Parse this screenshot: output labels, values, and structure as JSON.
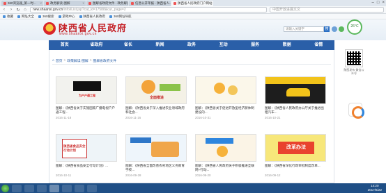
{
  "browser": {
    "tabs": [
      {
        "label": "360浏览器_第一时...",
        "active": false
      },
      {
        "label": "政务解读-图解",
        "active": false
      },
      {
        "label": "图解省政府文件 - 政务解读",
        "active": false
      },
      {
        "label": "信息公开年报 - 陕西省人...",
        "active": false
      },
      {
        "label": "陕西省人民政府门户网站",
        "active": true
      }
    ],
    "url_domain": "new.shaanxi.gov.cn",
    "url_path": "/info/iList.jsp?cat_id=17588&cur_page=2",
    "search_placeholder": "中国开放进展文文",
    "bookmarks": [
      "收藏",
      "网址大全",
      "360搜索",
      "游戏中心",
      "陕西省人民政府",
      "360网址导航"
    ]
  },
  "site": {
    "title": "陕西省人民政府",
    "url": "www.shaanxi.gov.cn",
    "search_placeholder": "请输入关键字",
    "search_button": "搜",
    "weather": "26°C",
    "nav": [
      "首页",
      "省政府",
      "省长",
      "新闻",
      "政务",
      "互动",
      "服务",
      "数据",
      "省情"
    ],
    "breadcrumb": [
      "首页",
      "政策解读·图解",
      "图解省政府文件"
    ],
    "qr_label": "陕西发布 微信公众号",
    "cards": [
      {
        "caption": "图解：《陕西省关于实施国家广播电视户户通工程...",
        "date": "2016-11-18"
      },
      {
        "caption": "图解：《陕西省关于深入推进农业领域政府和社会...",
        "date": "2016-11-16"
      },
      {
        "caption": "图解：《陕西省关于促进开放型经济新体制建设的...",
        "date": "2016-10-31"
      },
      {
        "caption": "图解：《陕西省人民政府办公厅关于推进出租汽车...",
        "date": "2016-10-21"
      },
      {
        "caption": "图解：《陕西省食品安全行动计划》...",
        "date": "2016-10-11"
      },
      {
        "caption": "图解：《陕西省全面改善农村地区义务教育学校...",
        "date": "2016-09-28"
      },
      {
        "caption": "图解：《陕西省人民政府关于积极推进互联网+行动...",
        "date": "2016-09-20"
      },
      {
        "caption": "图解：《陕西省深化行政审批制度改革...",
        "date": "2016-09-12"
      }
    ],
    "thumb_texts": {
      "t1": "为户户通工程",
      "t2": "全面推进",
      "t5_line1": "陕西省食品安全",
      "t5_line2": "行动计划",
      "t8": "改革办法"
    }
  },
  "taskbar": {
    "time": "14:20",
    "date": "2017/6/22"
  }
}
